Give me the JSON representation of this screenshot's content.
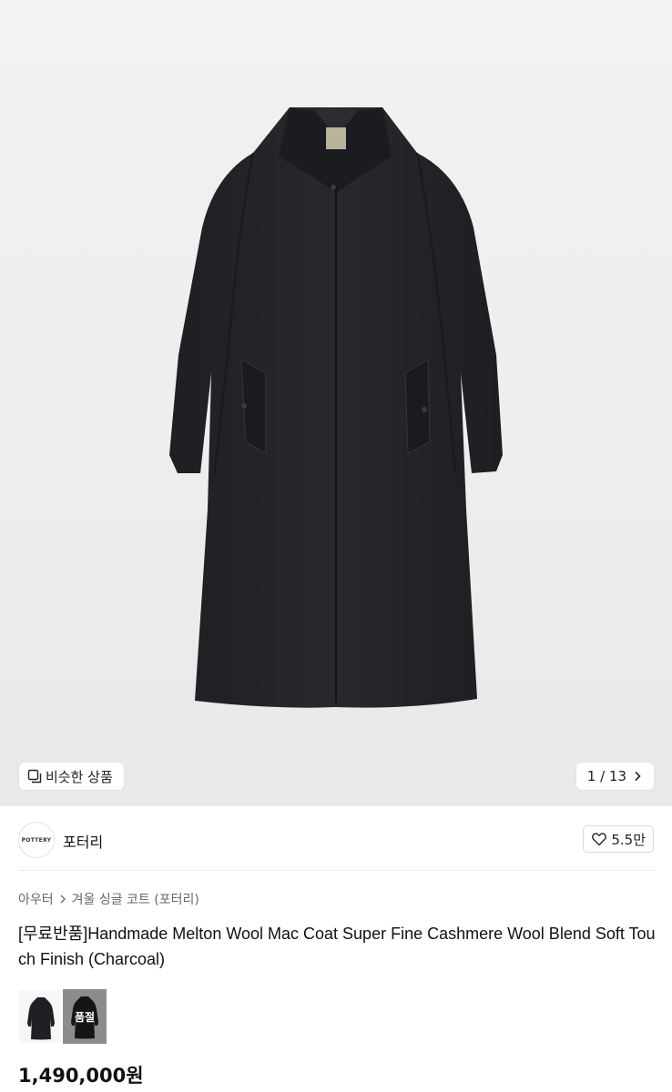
{
  "hero": {
    "similar_label": "비슷한 상품",
    "counter": "1 / 13"
  },
  "seller": {
    "logo_text": "POTTERY",
    "name": "포터리",
    "likes": "5.5만"
  },
  "breadcrumb": [
    "아우터",
    "겨울 싱글 코트 (포터리)"
  ],
  "product": {
    "title": "[무료반품]Handmade Melton Wool Mac Coat Super Fine Cashmere Wool Blend Soft Touch Finish (Charcoal)",
    "price": "1,490,000원"
  },
  "options": [
    {
      "soldout": false
    },
    {
      "soldout": true,
      "label": "품절"
    }
  ],
  "colors": {
    "coat": "#232427",
    "background": "#efefef"
  }
}
